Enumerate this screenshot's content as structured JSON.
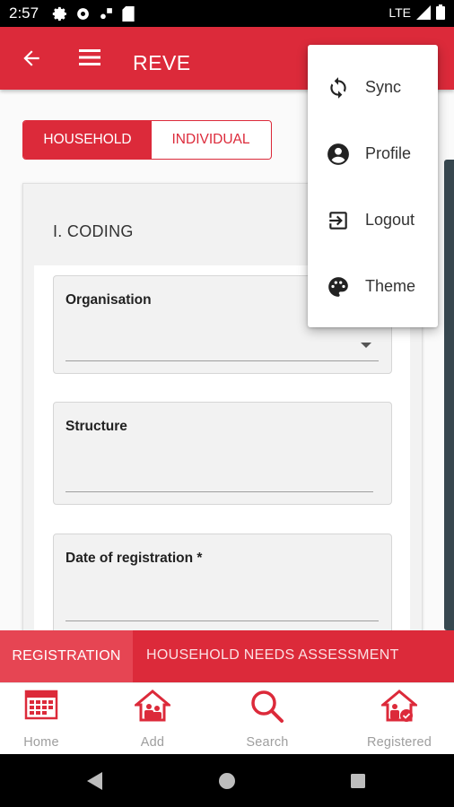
{
  "status_bar": {
    "time": "2:57",
    "network": "LTE"
  },
  "app_bar": {
    "title": "REVE"
  },
  "segment": {
    "household": "HOUSEHOLD",
    "individual": "INDIVIDUAL"
  },
  "form": {
    "section_title": "I. CODING",
    "fields": [
      {
        "label": "Organisation",
        "value": ""
      },
      {
        "label": "Structure",
        "value": ""
      },
      {
        "label": "Date of registration *",
        "value": ""
      }
    ]
  },
  "overflow_menu": {
    "items": [
      {
        "label": "Sync",
        "icon": "sync-icon"
      },
      {
        "label": "Profile",
        "icon": "account-circle-icon"
      },
      {
        "label": "Logout",
        "icon": "exit-icon"
      },
      {
        "label": "Theme",
        "icon": "palette-icon"
      }
    ]
  },
  "tabs": {
    "registration": "REGISTRATION",
    "needs": "HOUSEHOLD NEEDS ASSESSMENT"
  },
  "bottom_nav": [
    {
      "label": "Home",
      "icon": "calendar-grid-icon"
    },
    {
      "label": "Add",
      "icon": "add-household-icon"
    },
    {
      "label": "Search",
      "icon": "search-icon"
    },
    {
      "label": "Registered",
      "icon": "registered-household-icon"
    }
  ],
  "colors": {
    "primary": "#dc2a3a",
    "tab_active": "#e64553",
    "scrollbar": "#37474f"
  }
}
